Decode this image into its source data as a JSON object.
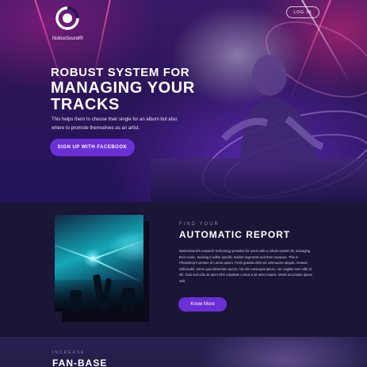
{
  "brand": {
    "name": "NoticeSound",
    "trademark": "®"
  },
  "header": {
    "login_label": "LOG IN"
  },
  "hero": {
    "line1": "ROBUST SYSTEM FOR",
    "line2": "MANAGING YOUR",
    "line3": "TRACKS",
    "subtitle": "This helps them to choose their single for an album but also where to promote themselves as an artist.",
    "cta_label": "SIGN UP WITH FACEBOOK"
  },
  "feature": {
    "eyebrow": "FIND YOUR",
    "title": "AUTOMATIC REPORT",
    "body": "NoticeSound's research technology provides for users with a robust system for managing their music, tracking it within specific market segments and then measure. This is Photoshop's version of Lorem Ipsum. Proin gravida nibh vel velit auctor aliquet. Aenean sollicitudin, lorem quis bibendum auctor, nisi elit consequat ipsum, nec sagittis sem nibh id elit. Duis sed odio sit amet nibh vulputate cursus a sit amet mauris. Morbi accumsan ipsum velit.",
    "button_label": "Know More"
  },
  "fanbase": {
    "eyebrow": "INCREASE",
    "title": "FAN-BASE"
  },
  "colors": {
    "accent": "#6b2fd6",
    "background": "#1b1536",
    "muted_label": "#8d86b0"
  }
}
